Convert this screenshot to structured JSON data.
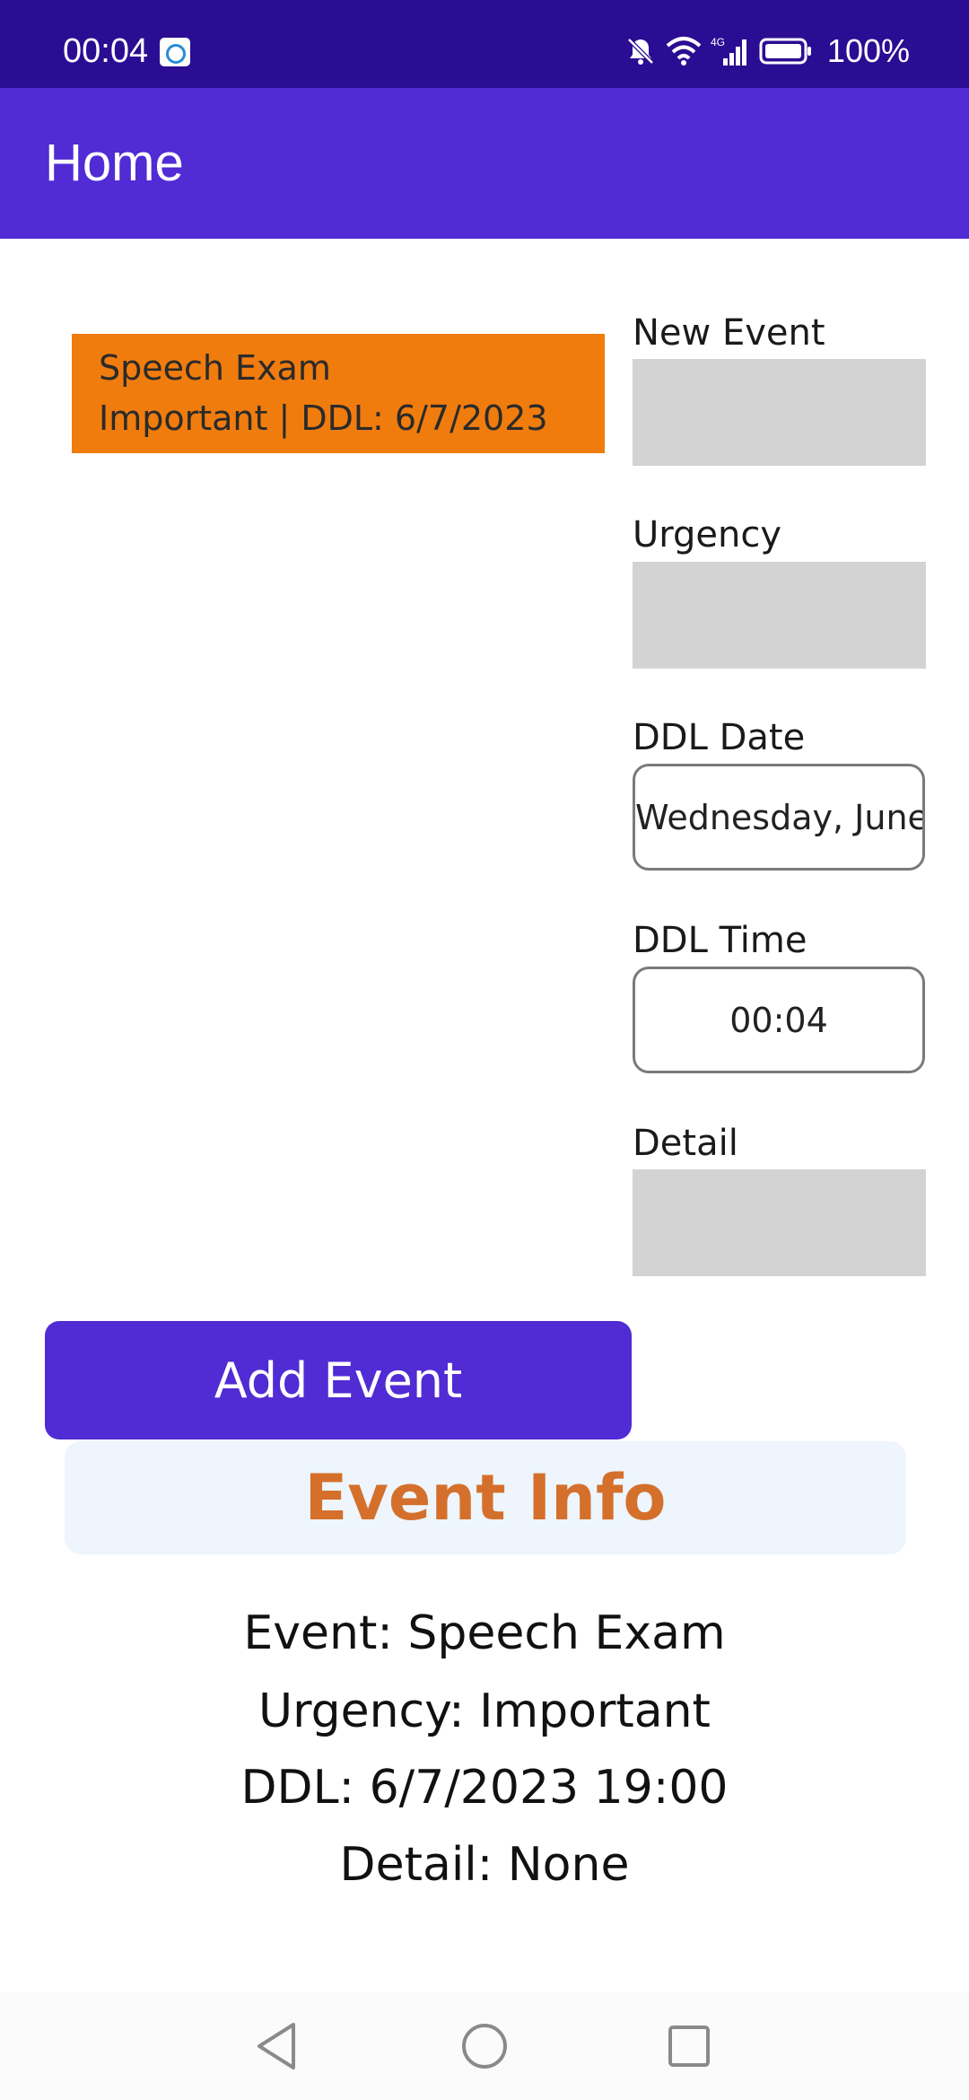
{
  "status_bar": {
    "time": "00:04",
    "network": "4G",
    "battery": "100%"
  },
  "app_bar": {
    "title": "Home"
  },
  "event_list": [
    {
      "name": "Speech Exam",
      "meta": "Important | DDL: 6/7/2023",
      "color": "#f07c0e"
    }
  ],
  "form": {
    "new_event_label": "New Event",
    "new_event_value": "",
    "urgency_label": "Urgency",
    "urgency_value": "",
    "ddl_date_label": "DDL Date",
    "ddl_date_value": "Wednesday, June",
    "ddl_time_label": "DDL Time",
    "ddl_time_value": "00:04",
    "detail_label": "Detail",
    "detail_value": ""
  },
  "add_button_label": "Add Event",
  "event_info": {
    "header": "Event Info",
    "event_line": "Event: Speech Exam",
    "urgency_line": "Urgency: Important",
    "ddl_line": "DDL: 6/7/2023 19:00",
    "detail_line": "Detail: None"
  },
  "colors": {
    "status_bar": "#2b0d93",
    "primary": "#512bd4",
    "event_card": "#f07c0e",
    "info_title": "#d4702c",
    "info_header_bg": "#eef5fd",
    "field_grey": "#d3d3d3"
  },
  "icons": {
    "status_left": "gallery-notification-icon",
    "status_right": [
      "mute-icon",
      "wifi-icon",
      "signal-icon",
      "battery-icon"
    ],
    "nav": [
      "back-icon",
      "home-icon",
      "recents-icon"
    ]
  }
}
